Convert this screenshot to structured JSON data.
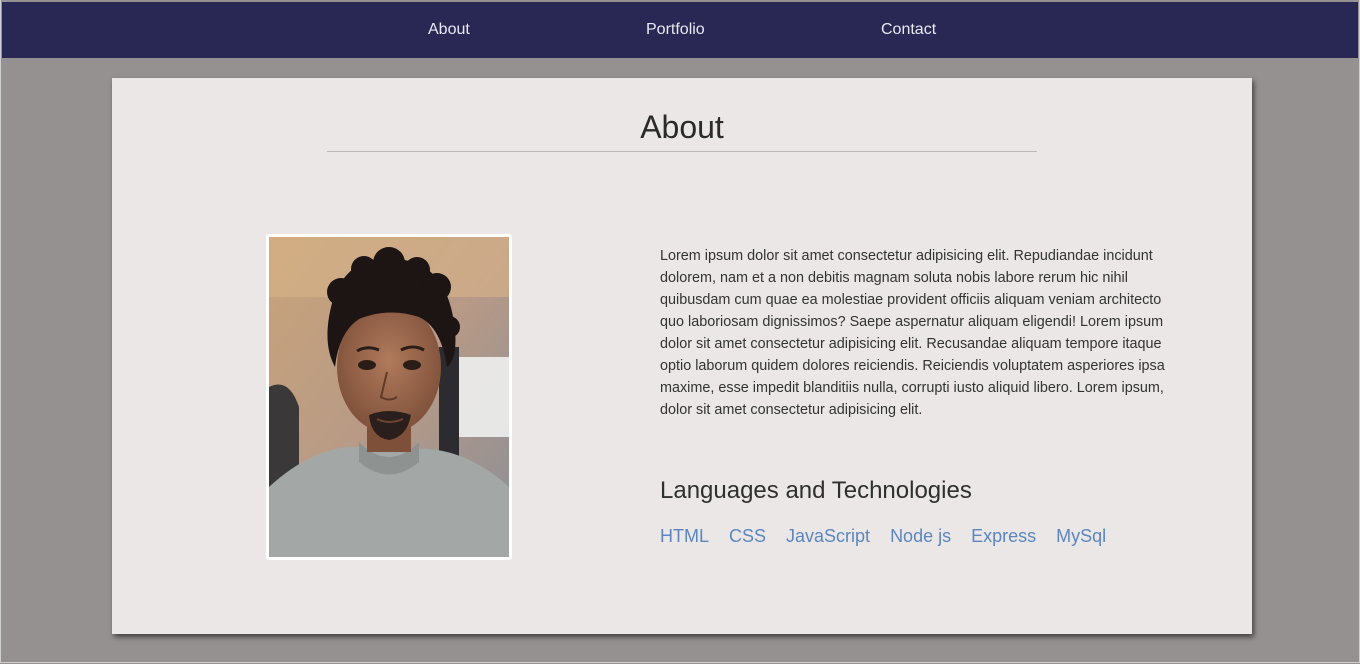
{
  "nav": {
    "items": [
      {
        "label": "About"
      },
      {
        "label": "Portfolio"
      },
      {
        "label": "Contact"
      }
    ],
    "background": "#292855"
  },
  "about": {
    "title": "About",
    "bio": "Lorem ipsum dolor sit amet consectetur adipisicing elit. Repudiandae incidunt dolorem, nam et a non debitis magnam soluta nobis labore rerum hic nihil quibusdam cum quae ea molestiae provident officiis aliquam veniam architecto quo laboriosam dignissimos? Saepe aspernatur aliquam eligendi! Lorem ipsum dolor sit amet consectetur adipisicing elit. Recusandae aliquam tempore itaque optio laborum quidem dolores reiciendis. Reiciendis voluptatem asperiores ipsa maxime, esse impedit blanditiis nulla, corrupti iusto aliquid libero. Lorem ipsum, dolor sit amet consectetur adipisicing elit.",
    "tech_title": "Languages and Technologies",
    "technologies": [
      {
        "label": "HTML"
      },
      {
        "label": "CSS"
      },
      {
        "label": "JavaScript"
      },
      {
        "label": "Node js"
      },
      {
        "label": "Express"
      },
      {
        "label": "MySql"
      }
    ],
    "link_color": "#5b86c0"
  },
  "colors": {
    "page_background": "#969191",
    "card_background": "#ebe7e6"
  }
}
